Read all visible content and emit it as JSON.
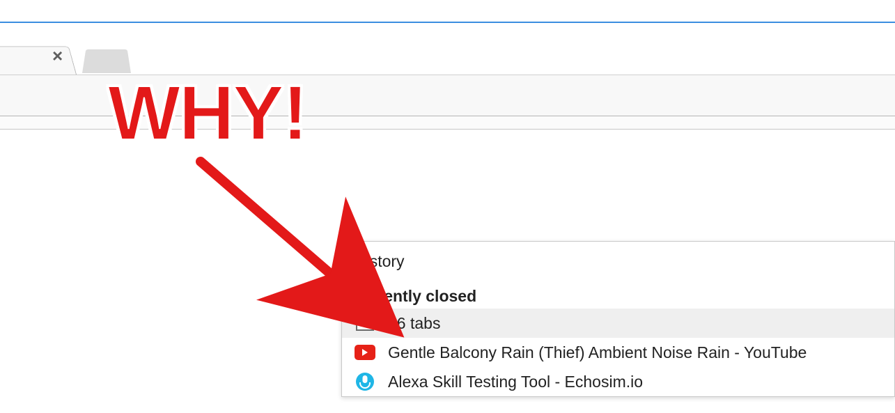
{
  "annotation": {
    "text": "WHY!"
  },
  "menu": {
    "history_label": "History",
    "recently_closed_label": "Recently closed",
    "items": [
      {
        "icon": "window-icon",
        "label": "36 tabs",
        "highlighted": true
      },
      {
        "icon": "youtube-icon",
        "label": "Gentle Balcony Rain (Thief) Ambient Noise Rain - YouTube",
        "highlighted": false
      },
      {
        "icon": "echosim-icon",
        "label": "Alexa Skill Testing Tool - Echosim.io",
        "highlighted": false
      }
    ]
  }
}
